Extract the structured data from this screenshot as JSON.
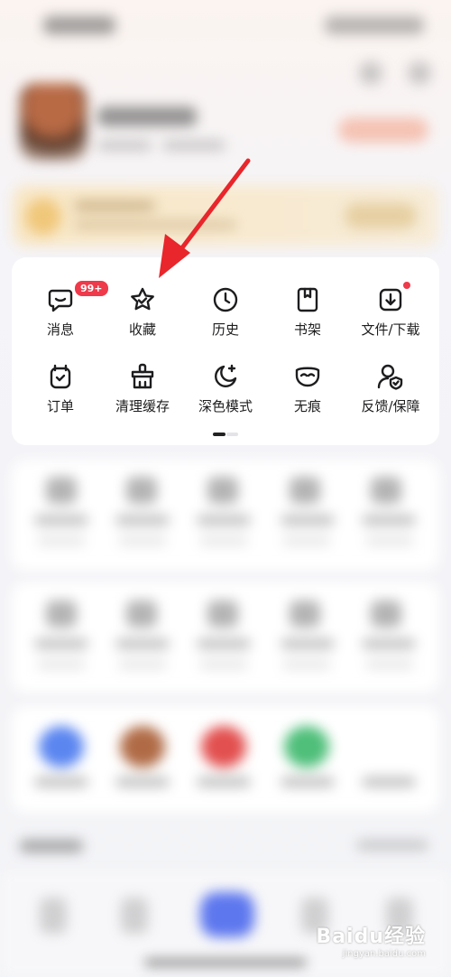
{
  "quick_menu": {
    "items": [
      {
        "label": "消息",
        "icon": "chat-bubble-icon",
        "badge": "99+"
      },
      {
        "label": "收藏",
        "icon": "star-icon"
      },
      {
        "label": "历史",
        "icon": "clock-icon"
      },
      {
        "label": "书架",
        "icon": "book-icon"
      },
      {
        "label": "文件/下载",
        "icon": "download-icon",
        "dot": true
      },
      {
        "label": "订单",
        "icon": "order-clock-icon"
      },
      {
        "label": "清理缓存",
        "icon": "broom-icon"
      },
      {
        "label": "深色模式",
        "icon": "moon-icon"
      },
      {
        "label": "无痕",
        "icon": "incognito-mask-icon"
      },
      {
        "label": "反馈/保障",
        "icon": "user-shield-icon"
      }
    ],
    "page_indicator": {
      "pages": 2,
      "active": 1
    }
  },
  "watermark": {
    "logo": "Baidu经验",
    "url": "jingyan.baidu.com"
  },
  "colors": {
    "badge": "#ee3a4a",
    "arrow": "#e8262b",
    "icon_stroke": "#1d1d1f",
    "tab_accent": "#5d77ee"
  }
}
